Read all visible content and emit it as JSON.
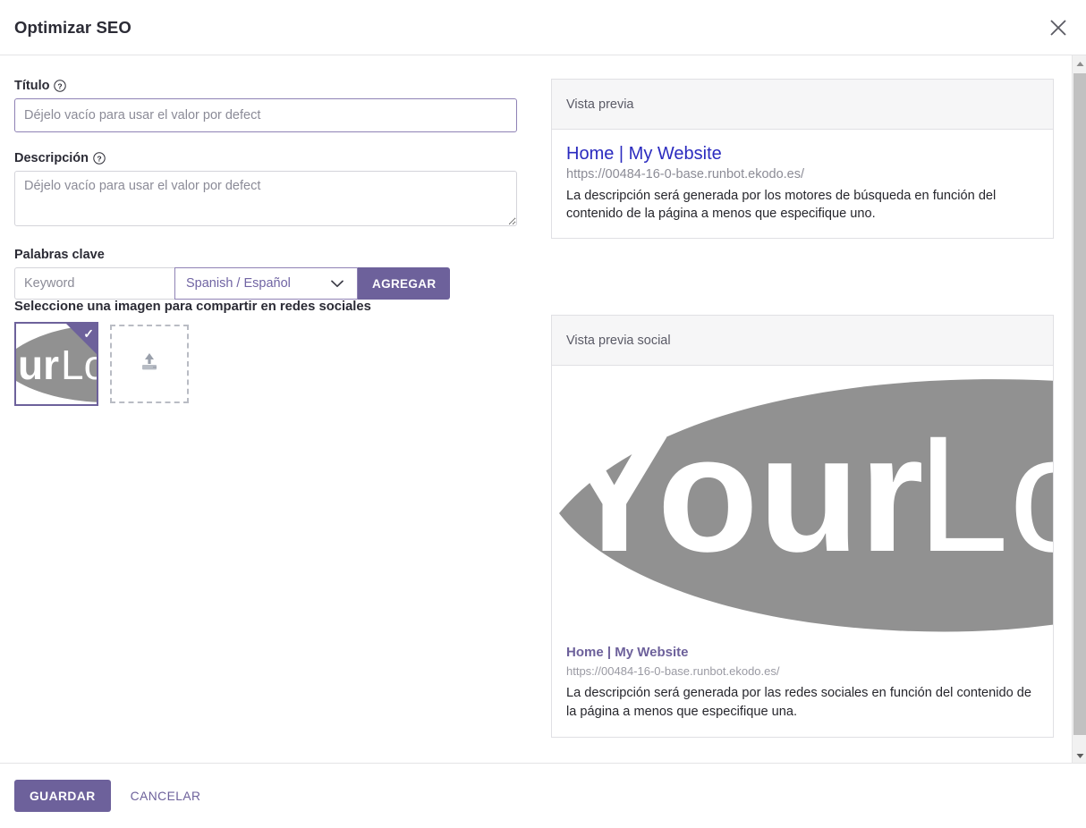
{
  "dialog": {
    "title": "Optimizar SEO",
    "close_icon": "close-icon"
  },
  "form": {
    "title_field": {
      "label": "Título",
      "help_icon": "question-circle-icon",
      "value": "",
      "placeholder": "Déjelo vacío para usar el valor por defect"
    },
    "description_field": {
      "label": "Descripción",
      "help_icon": "question-circle-icon",
      "value": "",
      "placeholder": "Déjelo vacío para usar el valor por defect"
    },
    "keywords": {
      "label": "Palabras clave",
      "keyword_value": "",
      "keyword_placeholder": "Keyword",
      "language_selected": "Spanish / Español",
      "caret_icon": "chevron-down-icon",
      "add_button": "AGREGAR"
    },
    "social_image": {
      "label": "Seleccione una imagen para compartir en redes sociales",
      "selected_badge_icon": "check-icon",
      "thumbnail_alt": "YourLogo",
      "upload_icon": "upload-icon"
    }
  },
  "previews": {
    "search": {
      "header": "Vista previa",
      "title": "Home | My Website",
      "url": "https://00484-16-0-base.runbot.ekodo.es/",
      "description": "La descripción será generada por los motores de búsqueda en función del contenido de la página a menos que especifique uno."
    },
    "social": {
      "header": "Vista previa social",
      "image_alt": "YourLogo",
      "title": "Home | My Website",
      "url": "https://00484-16-0-base.runbot.ekodo.es/",
      "description": "La descripción será generada por las redes sociales en función del contenido de la página a menos que especifique una."
    }
  },
  "footer": {
    "save_label": "GUARDAR",
    "cancel_label": "CANCELAR"
  },
  "colors": {
    "accent_purple": "#6d619b",
    "link_blue": "#2b2bbf",
    "muted_gray": "#8c8c96",
    "logo_gray": "#919191"
  },
  "scrollbar": {
    "up_arrow_icon": "triangle-up-icon",
    "down_arrow_icon": "triangle-down-icon"
  }
}
